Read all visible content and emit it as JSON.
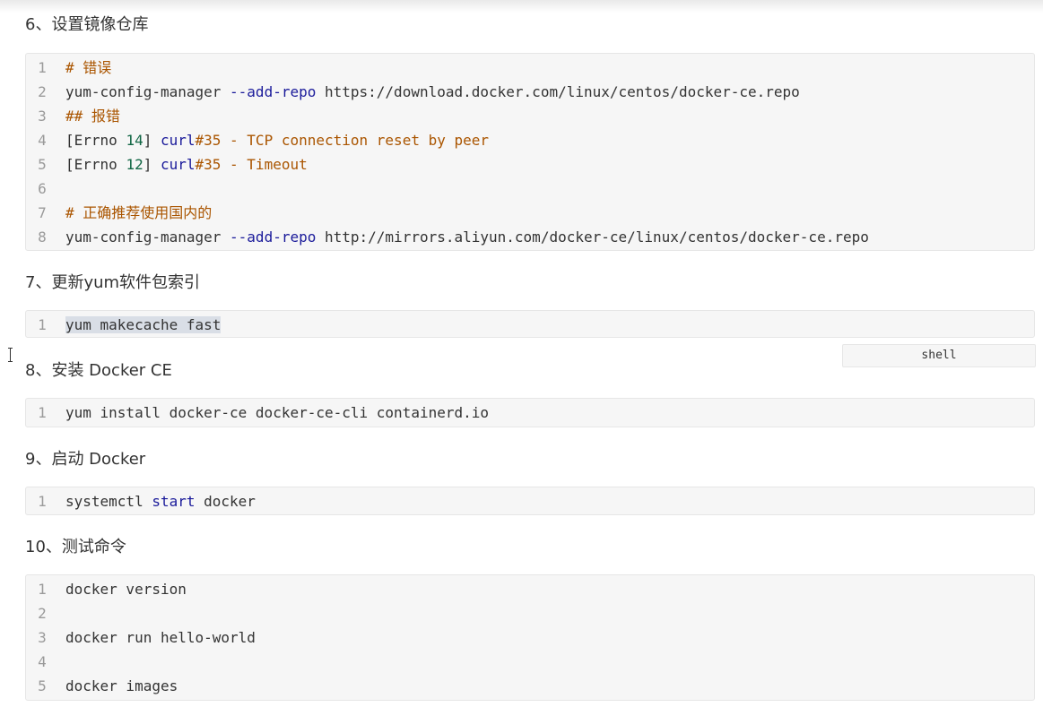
{
  "sections": [
    {
      "heading": "6、设置镜像仓库",
      "lines": [
        {
          "n": "1",
          "tokens": [
            {
              "t": "# 错误",
              "c": "comment"
            }
          ]
        },
        {
          "n": "2",
          "tokens": [
            {
              "t": "yum-config-manager ",
              "c": "plain"
            },
            {
              "t": "--add-repo",
              "c": "keyword"
            },
            {
              "t": " https://download.docker.com/linux/centos/docker-ce.repo",
              "c": "plain"
            }
          ]
        },
        {
          "n": "3",
          "tokens": [
            {
              "t": "## 报错",
              "c": "comment"
            }
          ]
        },
        {
          "n": "4",
          "tokens": [
            {
              "t": "[Errno ",
              "c": "plain"
            },
            {
              "t": "14",
              "c": "number"
            },
            {
              "t": "] ",
              "c": "plain"
            },
            {
              "t": "curl",
              "c": "keyword"
            },
            {
              "t": "#35 - TCP connection reset by peer",
              "c": "comment"
            }
          ]
        },
        {
          "n": "5",
          "tokens": [
            {
              "t": "[Errno ",
              "c": "plain"
            },
            {
              "t": "12",
              "c": "number"
            },
            {
              "t": "] ",
              "c": "plain"
            },
            {
              "t": "curl",
              "c": "keyword"
            },
            {
              "t": "#35 - Timeout",
              "c": "comment"
            }
          ]
        },
        {
          "n": "6",
          "tokens": []
        },
        {
          "n": "7",
          "tokens": [
            {
              "t": "# 正确推荐使用国内的",
              "c": "comment"
            }
          ]
        },
        {
          "n": "8",
          "tokens": [
            {
              "t": "yum-config-manager ",
              "c": "plain"
            },
            {
              "t": "--add-repo",
              "c": "keyword"
            },
            {
              "t": " http://mirrors.aliyun.com/docker-ce/linux/centos/docker-ce.repo",
              "c": "plain"
            }
          ]
        }
      ]
    },
    {
      "heading": "7、更新yum软件包索引",
      "lines": [
        {
          "n": "1",
          "tokens": [
            {
              "t": "yum makecache fast",
              "c": "sel"
            }
          ]
        }
      ]
    },
    {
      "heading": "8、安装 Docker CE",
      "lines": [
        {
          "n": "1",
          "tokens": [
            {
              "t": "yum install docker-ce docker-ce-cli containerd.io",
              "c": "plain"
            }
          ]
        }
      ]
    },
    {
      "heading": "9、启动 Docker",
      "lines": [
        {
          "n": "1",
          "tokens": [
            {
              "t": "systemctl ",
              "c": "plain"
            },
            {
              "t": "start",
              "c": "keyword"
            },
            {
              "t": " docker",
              "c": "plain"
            }
          ]
        }
      ]
    },
    {
      "heading": "10、测试命令",
      "lines": [
        {
          "n": "1",
          "tokens": [
            {
              "t": "docker version",
              "c": "plain"
            }
          ]
        },
        {
          "n": "2",
          "tokens": []
        },
        {
          "n": "3",
          "tokens": [
            {
              "t": "docker run hello-world",
              "c": "plain"
            }
          ]
        },
        {
          "n": "4",
          "tokens": []
        },
        {
          "n": "5",
          "tokens": [
            {
              "t": "docker images",
              "c": "plain"
            }
          ]
        }
      ]
    }
  ],
  "lang_tag": "shell"
}
